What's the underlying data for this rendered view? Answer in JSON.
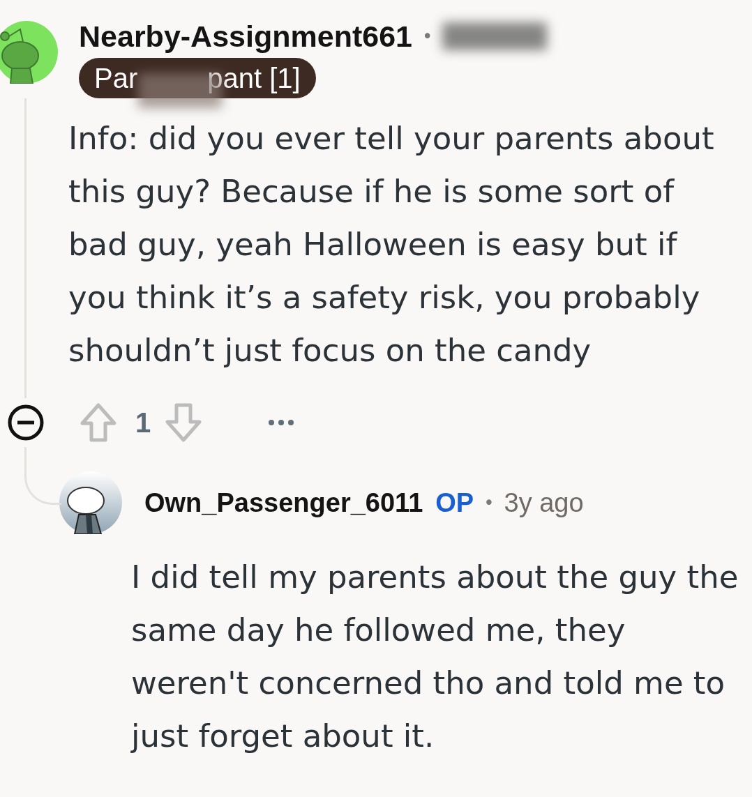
{
  "comment": {
    "author": "Nearby-Assignment661",
    "separator": "•",
    "flair": {
      "start": "Par",
      "end": "pant [1]"
    },
    "body": "Info: did you ever tell your parents about this guy? Because if he is some sort of bad guy, yeah Halloween is easy but if you think it’s a safety risk, you probably shouldn’t just focus on the candy",
    "score": "1",
    "collapse_expanded": true
  },
  "reply": {
    "author": "Own_Passenger_6011",
    "op_badge": "OP",
    "separator": "•",
    "time": "3y ago",
    "body": "I did tell my parents about the guy the same day he followed me, they weren't concerned tho and told me to just forget about it."
  }
}
